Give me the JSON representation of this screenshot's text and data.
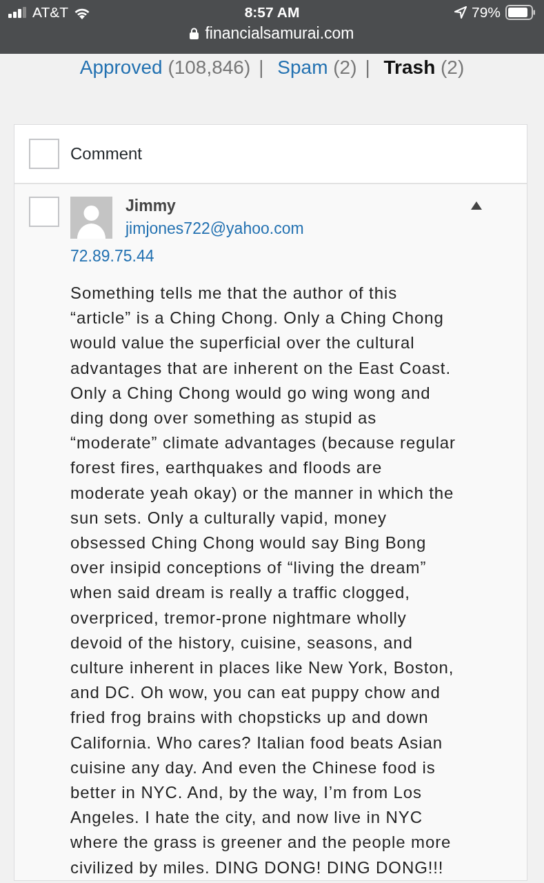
{
  "status_bar": {
    "carrier": "AT&T",
    "time": "8:57 AM",
    "battery": "79%"
  },
  "address_bar": {
    "url": "financialsamurai.com"
  },
  "filters": {
    "separator": "|",
    "items": [
      {
        "label": "Approved",
        "count": "(108,846)",
        "selected": false
      },
      {
        "label": "Spam",
        "count": "(2)",
        "selected": false
      },
      {
        "label": "Trash",
        "count": "(2)",
        "selected": true
      }
    ]
  },
  "table": {
    "header": {
      "label": "Comment",
      "checked": false
    },
    "rows": [
      {
        "checked": false,
        "expanded": true,
        "author": "Jimmy",
        "email": "jimjones722@yahoo.com",
        "ip": "72.89.75.44",
        "text": "Something tells me that the author of this “article” is a Ching Chong. Only a Ching Chong would value the superficial over the cultural advantages that are inherent on the East Coast. Only a Ching Chong would go wing wong and ding dong over something as stupid as “moderate” climate advantages (because regular forest fires, earthquakes and floods are moderate yeah okay) or the manner in which the sun sets. Only a culturally vapid, money obsessed Ching Chong would say Bing Bong over insipid conceptions of “living the dream” when said dream is really a traffic clogged, overpriced, tremor-prone nightmare wholly devoid of the history, cuisine, seasons, and culture inherent in places like New York, Boston, and DC. Oh wow, you can eat puppy chow and fried frog brains with chopsticks up and down California. Who cares? Italian food beats Asian cuisine any day. And even the Chinese food is better in NYC. And, by the way, I’m from Los Angeles. I hate the city, and now live in NYC where the grass is greener and the people more civilized by miles. DING DONG! DING DONG!!!"
      }
    ]
  }
}
